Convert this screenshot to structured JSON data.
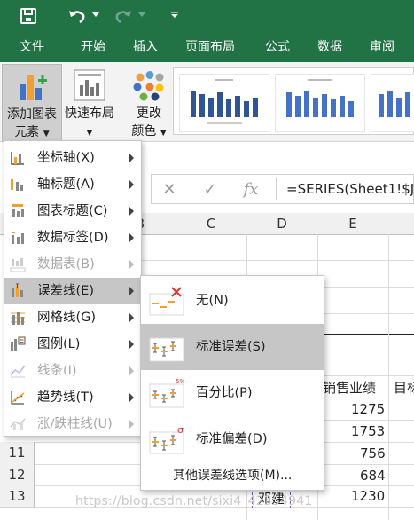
{
  "tabs": [
    {
      "label": "文件"
    },
    {
      "label": "开始"
    },
    {
      "label": "插入"
    },
    {
      "label": "页面布局"
    },
    {
      "label": "公式"
    },
    {
      "label": "数据"
    },
    {
      "label": "审阅"
    }
  ],
  "ribbon": {
    "add_element_label1": "添加图表",
    "add_element_label2": "元素",
    "quick_layout_label1": "快速布局",
    "change_color_label1": "更改",
    "change_color_label2": "颜色"
  },
  "formula_bar": {
    "formula": "=SERIES(Sheet1!$J$"
  },
  "grid": {
    "columns": [
      "B",
      "C",
      "D",
      "E"
    ],
    "rows": [
      "11",
      "12",
      "13"
    ],
    "header_cells": [
      "销售业绩",
      "目标"
    ],
    "values": [
      "1275",
      "1753",
      "756",
      "684",
      "1230"
    ],
    "partial_name": "邓建"
  },
  "menu1": {
    "items": [
      {
        "label": "坐标轴(X)",
        "icon": "axes-icon"
      },
      {
        "label": "轴标题(A)",
        "icon": "axis-title-icon"
      },
      {
        "label": "图表标题(C)",
        "icon": "chart-title-icon"
      },
      {
        "label": "数据标签(D)",
        "icon": "data-labels-icon"
      },
      {
        "label": "数据表(B)",
        "icon": "data-table-icon"
      },
      {
        "label": "误差线(E)",
        "icon": "error-bars-icon"
      },
      {
        "label": "网格线(G)",
        "icon": "gridlines-icon"
      },
      {
        "label": "图例(L)",
        "icon": "legend-icon"
      },
      {
        "label": "线条(I)",
        "icon": "lines-icon"
      },
      {
        "label": "趋势线(T)",
        "icon": "trendline-icon"
      },
      {
        "label": "涨/跌柱线(U)",
        "icon": "up-down-bars-icon"
      }
    ]
  },
  "menu2": {
    "items": [
      {
        "label": "无(N)",
        "icon": "no-error-bars-icon"
      },
      {
        "label": "标准误差(S)",
        "icon": "standard-error-icon"
      },
      {
        "label": "百分比(P)",
        "icon": "percentage-icon",
        "badge": "5%"
      },
      {
        "label": "标准偏差(D)",
        "icon": "standard-deviation-icon",
        "badge": "σ"
      }
    ],
    "more_options": "其他误差线选项(M)..."
  },
  "watermark": "https://blog.csdn.net/sixi4_42354941",
  "colors": {
    "excel_green": "#217346",
    "menu_highlight": "#c6c6c6"
  }
}
